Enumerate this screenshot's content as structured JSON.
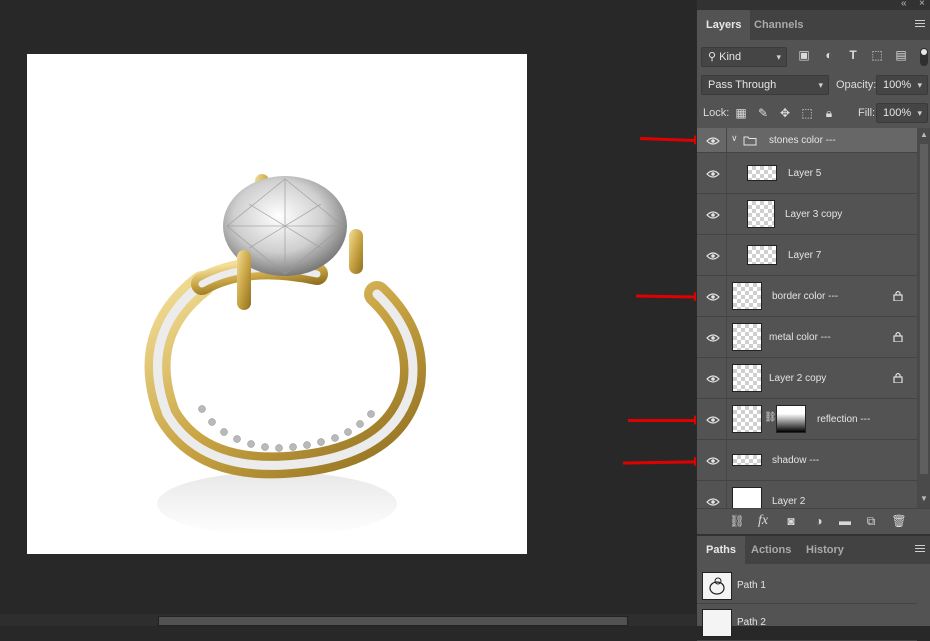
{
  "panel": {
    "top_controls": [
      "double-chevron-icon",
      "close-icon"
    ],
    "tabs": [
      {
        "label": "Layers",
        "active": true
      },
      {
        "label": "Channels",
        "active": false
      }
    ],
    "filter": {
      "kind_label": "Kind"
    },
    "blend_mode": "Pass Through",
    "opacity_label": "Opacity:",
    "opacity_value": "100%",
    "lock_label": "Lock:",
    "fill_label": "Fill:",
    "fill_value": "100%"
  },
  "layers": [
    {
      "name": "stones color ---",
      "type": "group",
      "visible": true,
      "expanded": true
    },
    {
      "name": "Layer 5",
      "type": "layer",
      "visible": true,
      "indented": true,
      "locked": false
    },
    {
      "name": "Layer 3 copy",
      "type": "layer",
      "visible": true,
      "indented": true,
      "locked": false
    },
    {
      "name": "Layer 7",
      "type": "layer",
      "visible": true,
      "indented": true,
      "locked": false
    },
    {
      "name": "border color ---",
      "type": "layer",
      "visible": true,
      "indented": false,
      "locked": true
    },
    {
      "name": "metal color ---",
      "type": "layer",
      "visible": true,
      "indented": false,
      "locked": true
    },
    {
      "name": "Layer 2 copy",
      "type": "layer",
      "visible": true,
      "indented": false,
      "locked": true
    },
    {
      "name": "reflection ---",
      "type": "layer",
      "visible": true,
      "indented": false,
      "locked": false,
      "has_mask": true
    },
    {
      "name": "shadow ---",
      "type": "layer",
      "visible": true,
      "indented": false,
      "locked": false
    },
    {
      "name": "Layer 2",
      "type": "layer",
      "visible": true,
      "indented": false,
      "locked": false
    }
  ],
  "bottom_tools": [
    "link-icon",
    "fx-icon",
    "mask-icon",
    "adjustment-icon",
    "folder-icon",
    "new-layer-icon",
    "trash-icon"
  ],
  "fx_label": "fx",
  "paths_panel": {
    "tabs": [
      {
        "label": "Paths",
        "active": true
      },
      {
        "label": "Actions",
        "active": false
      },
      {
        "label": "History",
        "active": false
      }
    ],
    "paths": [
      {
        "name": "Path 1"
      },
      {
        "name": "Path 2"
      }
    ]
  },
  "colors": {
    "annotation_arrow": "#e00000",
    "panel_bg": "#535353",
    "canvas_bg": "#282828"
  }
}
